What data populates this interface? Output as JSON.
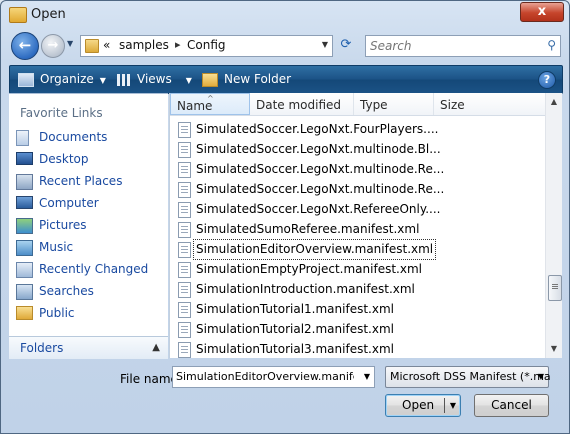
{
  "window": {
    "title": "Open",
    "close_label": "x"
  },
  "address": {
    "prefix": "«",
    "crumbs": [
      "samples",
      "Config"
    ],
    "search_placeholder": "Search"
  },
  "toolbar": {
    "organize": "Organize",
    "views": "Views",
    "new_folder": "New Folder",
    "help": "?"
  },
  "sidebar": {
    "title": "Favorite Links",
    "items": [
      {
        "label": "Documents",
        "icon": "documents-icon"
      },
      {
        "label": "Desktop",
        "icon": "desktop-icon"
      },
      {
        "label": "Recent Places",
        "icon": "recent-places-icon"
      },
      {
        "label": "Computer",
        "icon": "computer-icon"
      },
      {
        "label": "Pictures",
        "icon": "pictures-icon"
      },
      {
        "label": "Music",
        "icon": "music-icon"
      },
      {
        "label": "Recently Changed",
        "icon": "recently-changed-icon"
      },
      {
        "label": "Searches",
        "icon": "searches-icon"
      },
      {
        "label": "Public",
        "icon": "public-folder-icon"
      }
    ],
    "folders_label": "Folders"
  },
  "columns": [
    "Name",
    "Date modified",
    "Type",
    "Size"
  ],
  "files": [
    "SimulatedSoccer.LegoNxt.FourPlayers....",
    "SimulatedSoccer.LegoNxt.multinode.Bl...",
    "SimulatedSoccer.LegoNxt.multinode.Re...",
    "SimulatedSoccer.LegoNxt.multinode.Re...",
    "SimulatedSoccer.LegoNxt.RefereeOnly....",
    "SimulatedSumoReferee.manifest.xml",
    "SimulationEditorOverview.manifest.xml",
    "SimulationEmptyProject.manifest.xml",
    "SimulationIntroduction.manifest.xml",
    "SimulationTutorial1.manifest.xml",
    "SimulationTutorial2.manifest.xml",
    "SimulationTutorial3.manifest.xml"
  ],
  "selected_index": 6,
  "footer": {
    "filename_label": "File name:",
    "filename_value": "SimulationEditorOverview.manifest.xm",
    "file_type": "Microsoft DSS Manifest (*.ma",
    "open_label": "Open",
    "cancel_label": "Cancel"
  }
}
